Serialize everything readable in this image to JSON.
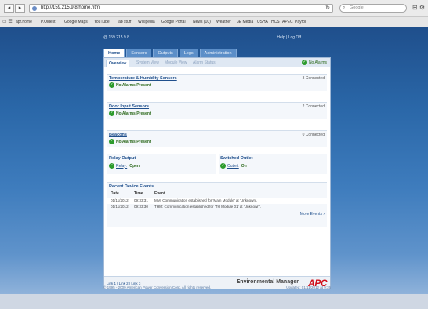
{
  "browser": {
    "url": "http://159.215.9.8/home.htm",
    "search_placeholder": "Google",
    "bookmarks": [
      "apr.home",
      "P.Oldest",
      "Google Maps",
      "YouTube",
      "lab stuff",
      "Wikipedia",
      "Google Portal",
      "News (10)",
      "Weather",
      "3E Media",
      "USHA",
      "HCS",
      "APEC",
      "Payroll"
    ]
  },
  "header": {
    "ip": "@ 159.215.9.8",
    "help_links": "Help | Log Off"
  },
  "tabs": [
    "Home",
    "Sensors",
    "Outputs",
    "Logs",
    "Administration"
  ],
  "subtabs": [
    "Overview",
    "System View",
    "Module View",
    "Alarm Status"
  ],
  "alarm_top": "No Alarms",
  "sections": [
    {
      "title": "Temperature & Humidity Sensors",
      "count": "3 Connected",
      "status": "No Alarms Present"
    },
    {
      "title": "Door Input Sensors",
      "count": "2 Connected",
      "status": "No Alarms Present"
    },
    {
      "title": "Beacons",
      "count": "0 Connected",
      "status": "No Alarms Present"
    }
  ],
  "relay": {
    "title": "Relay Output",
    "item": "Relay:",
    "value": "Open"
  },
  "outlet": {
    "title": "Switched Outlet",
    "item": "Outlet:",
    "value": "On"
  },
  "events": {
    "title": "Recent Device Events",
    "headers": [
      "Date",
      "Time",
      "Event"
    ],
    "rows": [
      {
        "date": "01/11/2012",
        "time": "09:33:31",
        "event": "MM: Communication established for 'Main Module' at 'Unknown'."
      },
      {
        "date": "01/11/2012",
        "time": "09:33:30",
        "event": "THM: Communication established for 'TH Module 01' at 'Unknown'."
      }
    ],
    "more": "More Events ›"
  },
  "footer": {
    "links": "Link 1 | Link 2 | Link 3",
    "product": "Environmental Manager",
    "logo": "APC"
  },
  "copyright": "© 1995 - 2009 American Power Conversion Corp. All rights reserved.",
  "updated": "Updated: 01/11/2012 at 9:35"
}
